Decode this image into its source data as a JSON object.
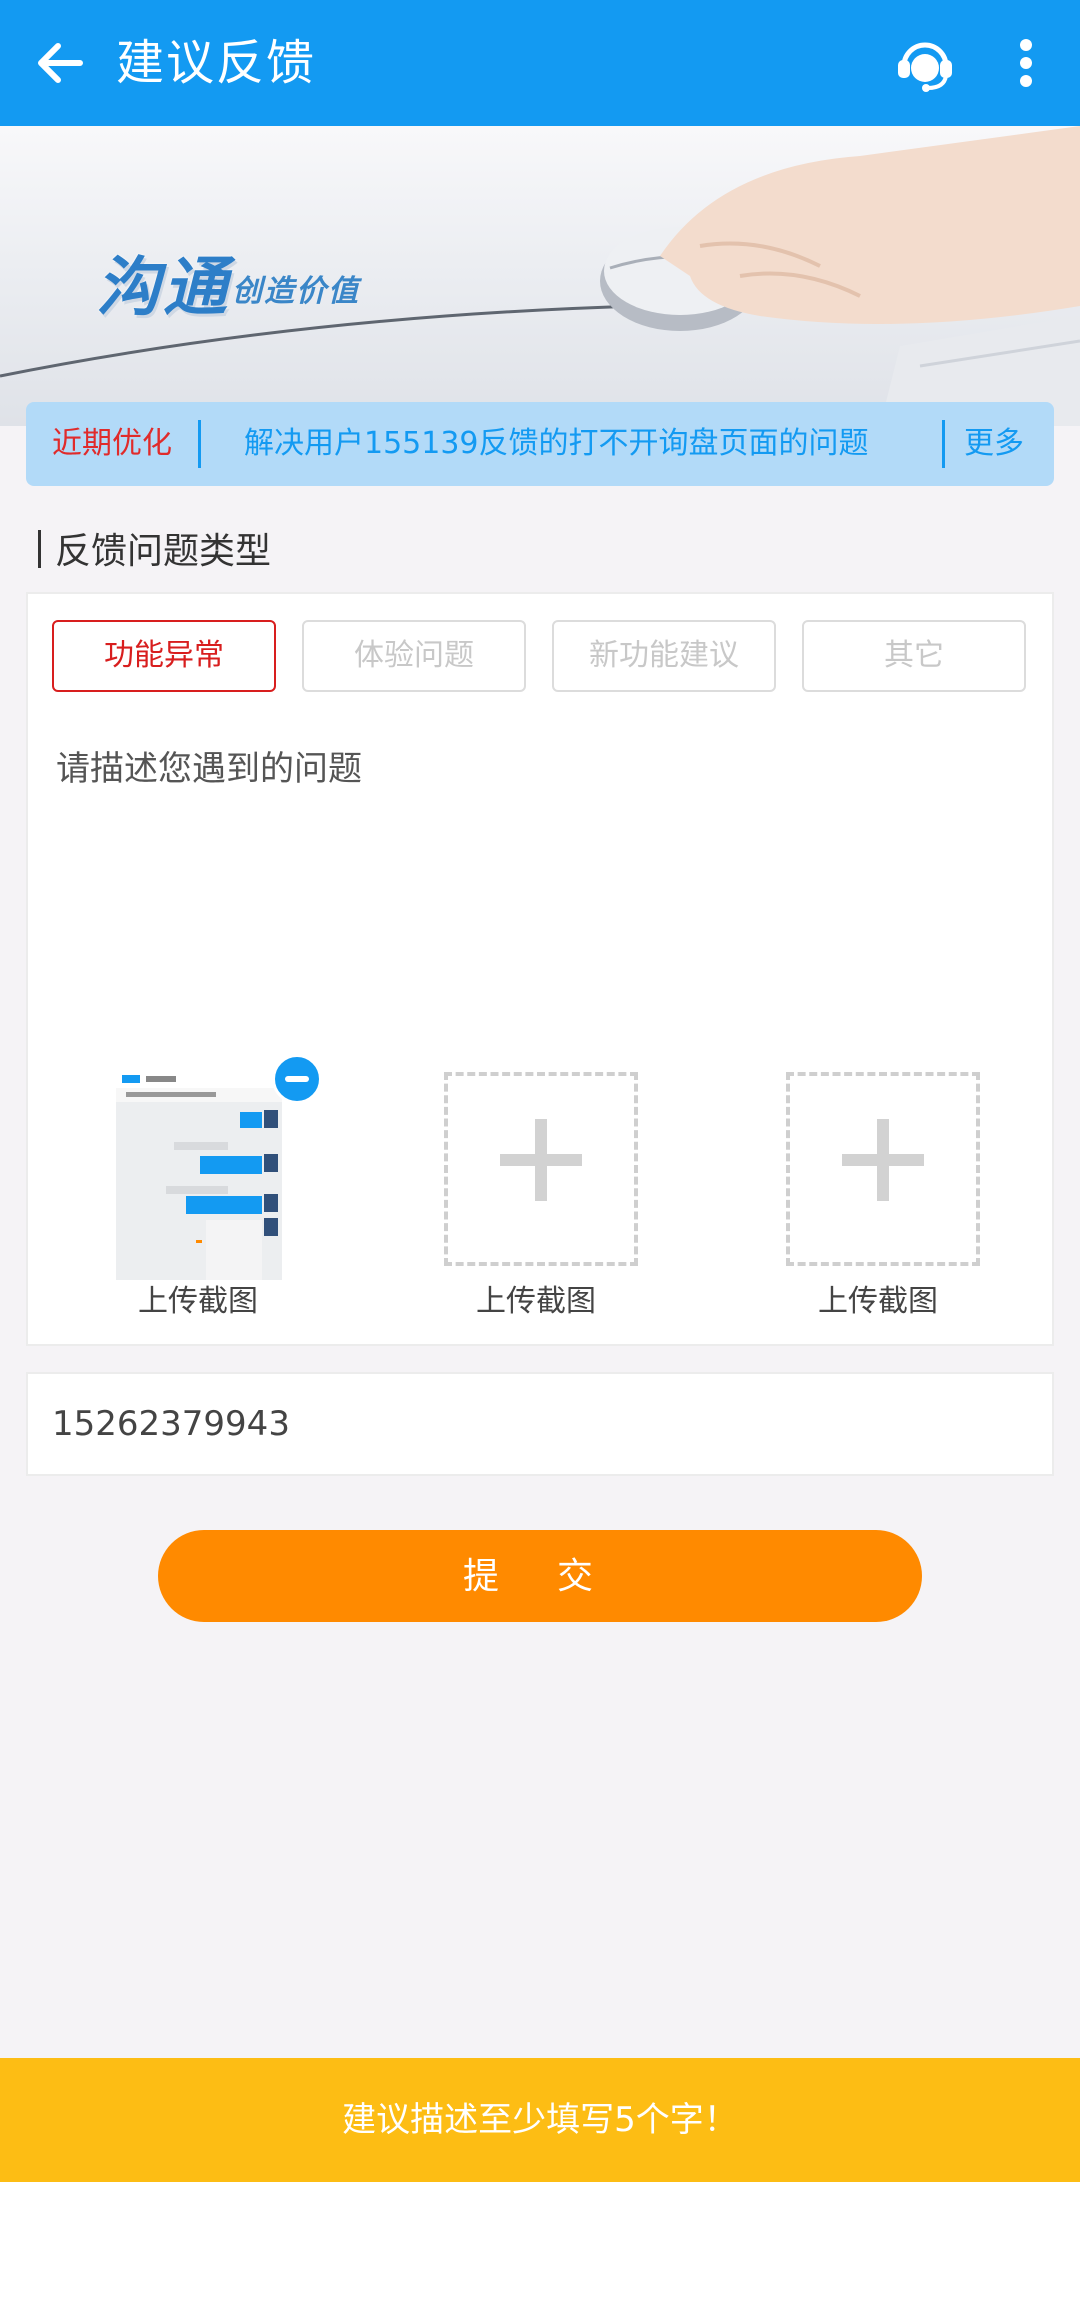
{
  "app_bar": {
    "title": "建议反馈",
    "back_icon": "arrow-left-icon",
    "service_icon": "customer-service-icon",
    "menu_icon": "more-vert-icon",
    "background": "#139af2"
  },
  "banner": {
    "slogan_main": "沟通",
    "slogan_sub": "创造价值"
  },
  "notice": {
    "tag": "近期优化",
    "message": "解决用户155139反馈的打不开询盘页面的问题",
    "more": "更多"
  },
  "feedback": {
    "section_title": "反馈问题类型",
    "types": [
      {
        "label": "功能异常",
        "selected": true
      },
      {
        "label": "体验问题",
        "selected": false
      },
      {
        "label": "新功能建议",
        "selected": false
      },
      {
        "label": "其它",
        "selected": false
      }
    ],
    "description_placeholder": "请描述您遇到的问题",
    "uploads": [
      {
        "label": "上传截图",
        "has_image": true
      },
      {
        "label": "上传截图",
        "has_image": false
      },
      {
        "label": "上传截图",
        "has_image": false
      }
    ]
  },
  "contact": {
    "phone_value": "15262379943"
  },
  "submit_label": "提 交",
  "toast": "建议描述至少填写5个字！",
  "colors": {
    "primary": "#139af2",
    "accent_red": "#d81e1e",
    "submit": "#ff8a00",
    "toast": "#fdbd14"
  }
}
